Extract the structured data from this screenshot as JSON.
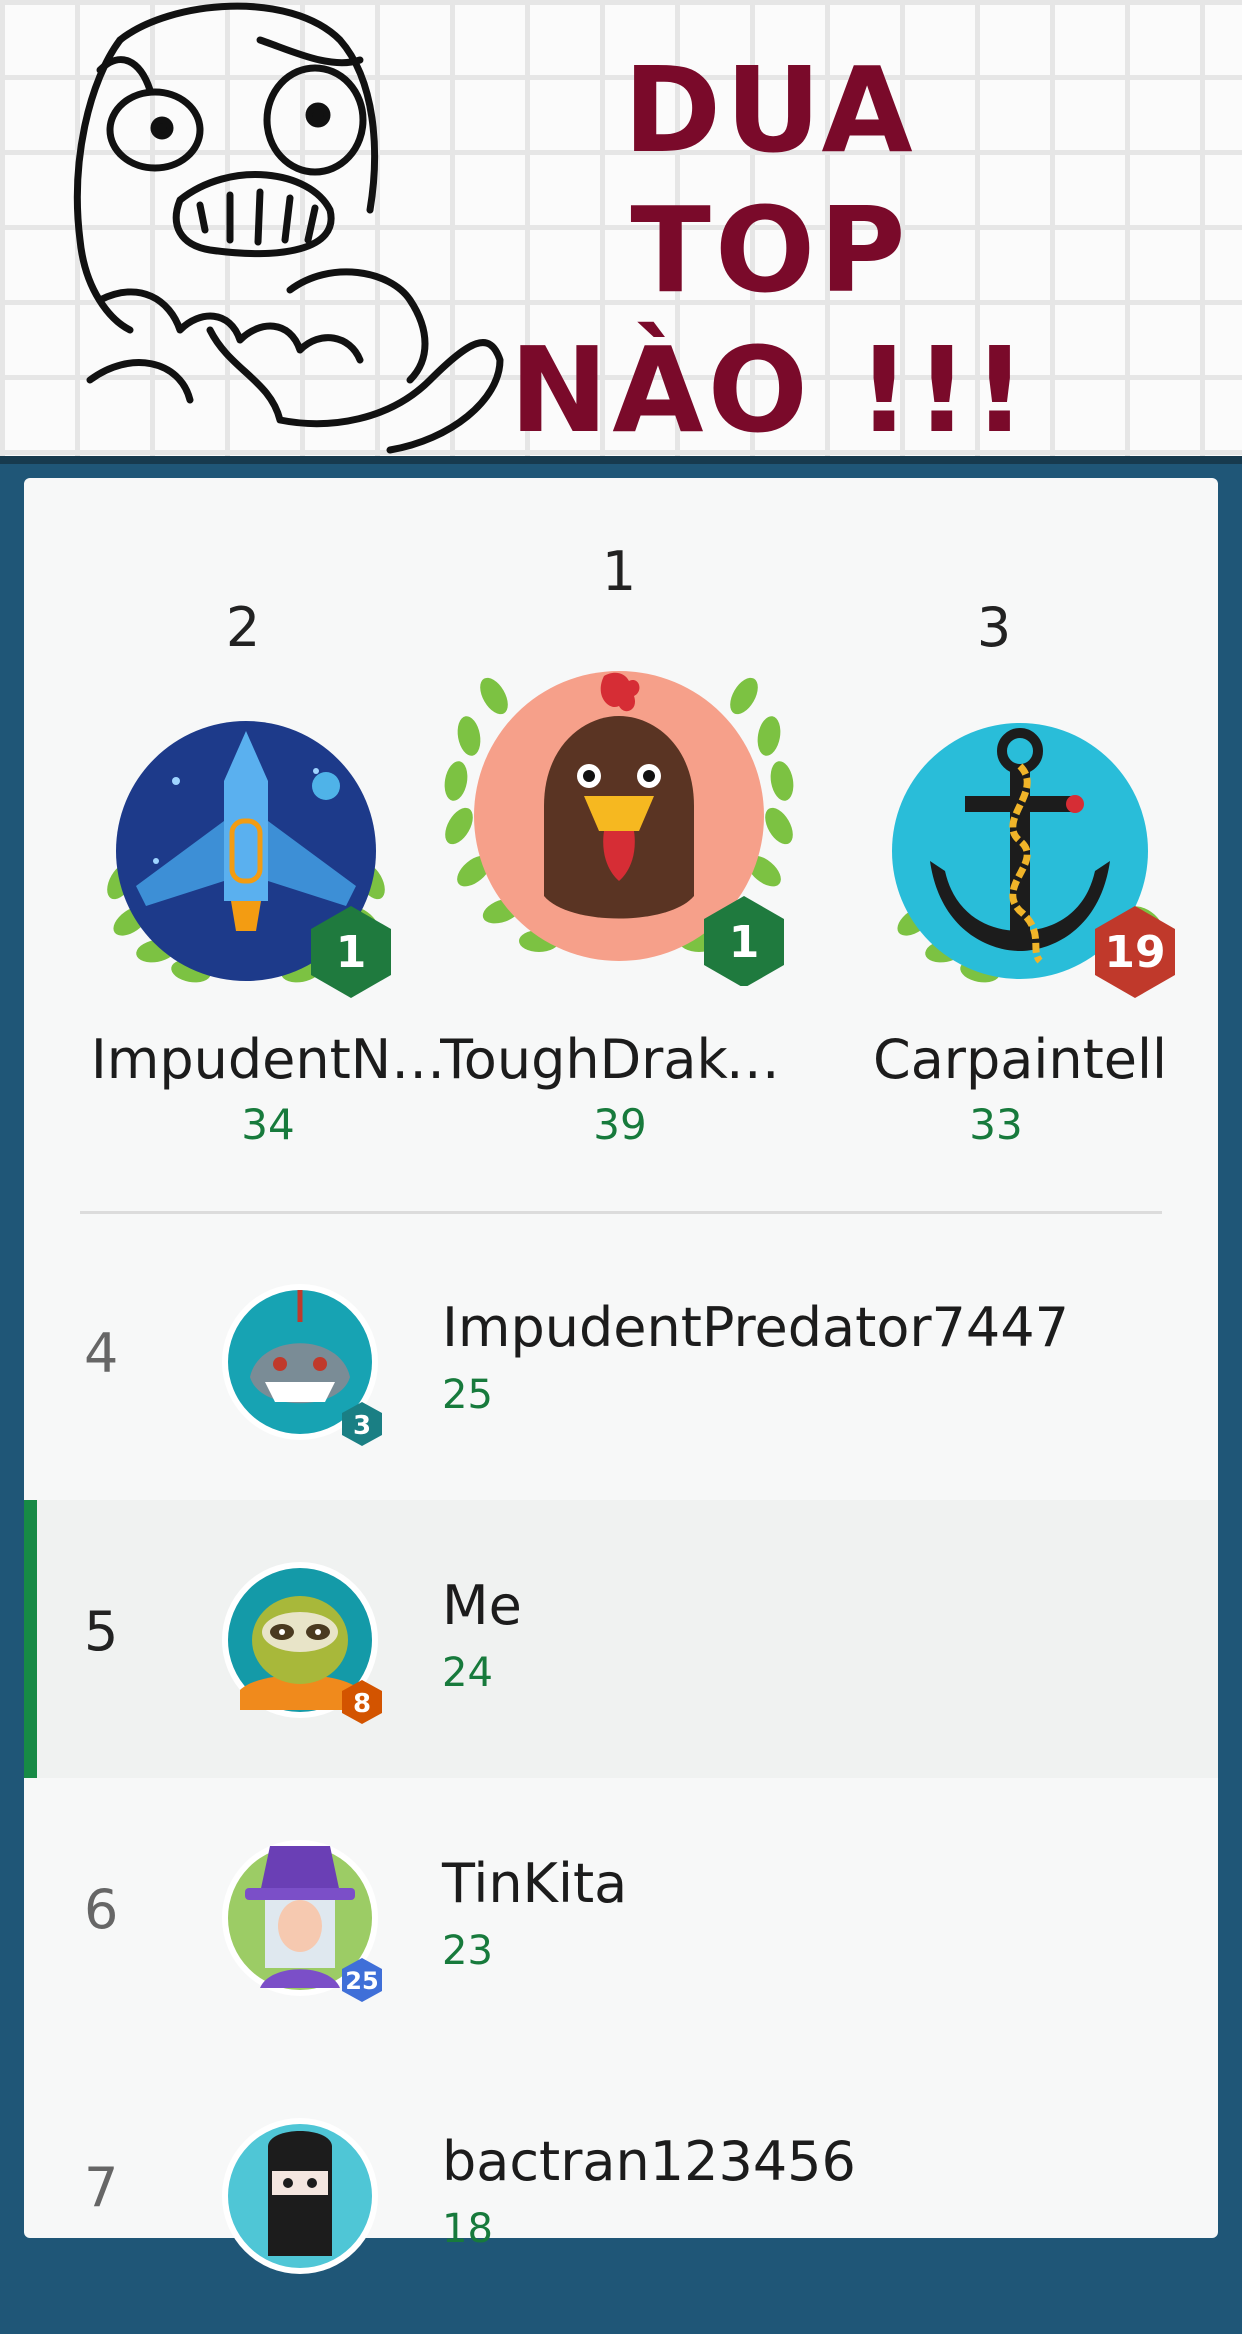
{
  "banner": {
    "title_line1": "DUA TOP",
    "title_line2": "NÀO !!!",
    "title_color": "#7a0a2a"
  },
  "podium": [
    {
      "rank": "2",
      "name": "ImpudentN…",
      "score": "34",
      "avatar": "spaceship-icon",
      "level": "1",
      "level_color": "#1f7a3e"
    },
    {
      "rank": "1",
      "name": "ToughDrake…",
      "score": "39",
      "avatar": "rooster-icon",
      "level": "1",
      "level_color": "#1f7a3e"
    },
    {
      "rank": "3",
      "name": "Carpaintell",
      "score": "33",
      "avatar": "anchor-icon",
      "level": "19",
      "level_color": "#c0392b"
    }
  ],
  "rows": [
    {
      "rank": "4",
      "name": "ImpudentPredator7447",
      "score": "25",
      "avatar": "shark-icon",
      "level": "3",
      "level_color": "#1a7f84"
    },
    {
      "rank": "5",
      "name": "Me",
      "score": "24",
      "avatar": "sloth-icon",
      "level": "8",
      "level_color": "#d35400",
      "highlighted": true
    },
    {
      "rank": "6",
      "name": "TinKita",
      "score": "23",
      "avatar": "witch-icon",
      "level": "25",
      "level_color": "#3f6fd8"
    },
    {
      "rank": "7",
      "name": "bactran123456",
      "score": "18",
      "avatar": "ninja-icon",
      "level": "",
      "level_color": "#3f6fd8"
    }
  ],
  "colors": {
    "accent_green": "#177a3c",
    "background_blue": "#1f5677"
  }
}
